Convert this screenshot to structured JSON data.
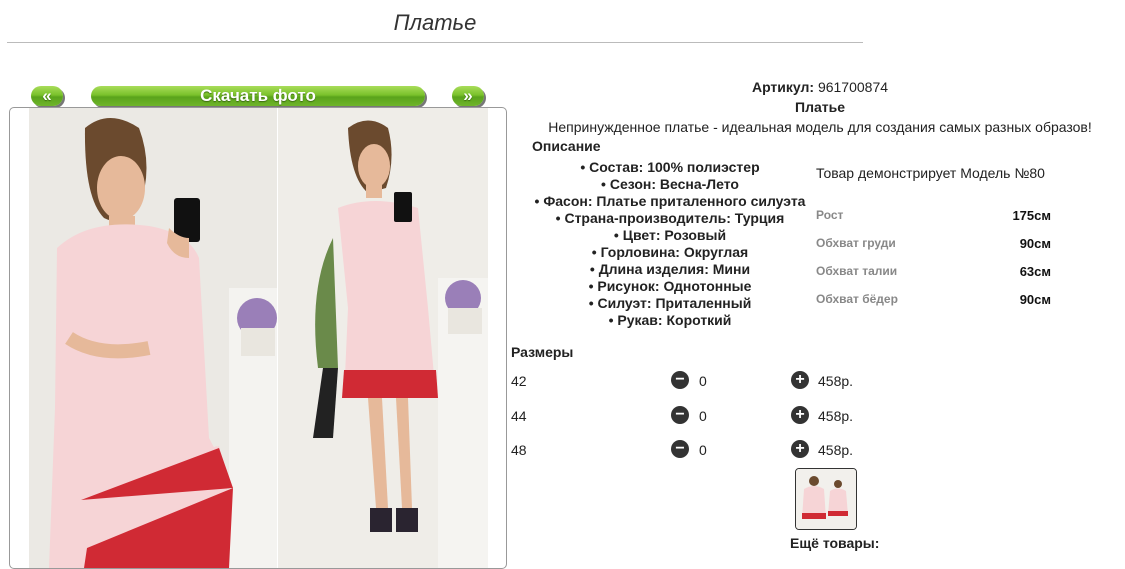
{
  "page": {
    "title": "Платье"
  },
  "gallery": {
    "prev_label": "«",
    "download_label": "Скачать фото",
    "next_label": "»"
  },
  "product": {
    "article_label": "Артикул:",
    "article_value": "961700874",
    "name": "Платье",
    "description": "Непринужденное платье - идеальная модель для создания самых разных образов!",
    "desc_heading": "Описание",
    "specs": [
      "Состав: 100% полиэстер",
      "Сезон: Весна-Лето",
      "Фасон: Платье приталенного силуэта",
      "Страна-производитель: Турция",
      "Цвет: Розовый",
      "Горловина: Округлая",
      "Длина изделия: Мини",
      "Рисунок: Однотонные",
      "Силуэт: Приталенный",
      "Рукав: Короткий"
    ]
  },
  "model": {
    "title": "Товар демонстрирует Модель №80",
    "rows": [
      {
        "label": "Рост",
        "value": "175см"
      },
      {
        "label": "Обхват груди",
        "value": "90см"
      },
      {
        "label": "Обхват талии",
        "value": "63см"
      },
      {
        "label": "Обхват бёдер",
        "value": "90см"
      }
    ]
  },
  "sizes": {
    "heading": "Размеры",
    "rows": [
      {
        "size": "42",
        "qty": "0",
        "price": "458р."
      },
      {
        "size": "44",
        "qty": "0",
        "price": "458р."
      },
      {
        "size": "48",
        "qty": "0",
        "price": "458р."
      }
    ]
  },
  "more": {
    "label": "Ещё товары:"
  },
  "colors": {
    "dress_pink": "#f6d4d6",
    "hem_red": "#d02a34",
    "button_green": "#7ac12b"
  }
}
